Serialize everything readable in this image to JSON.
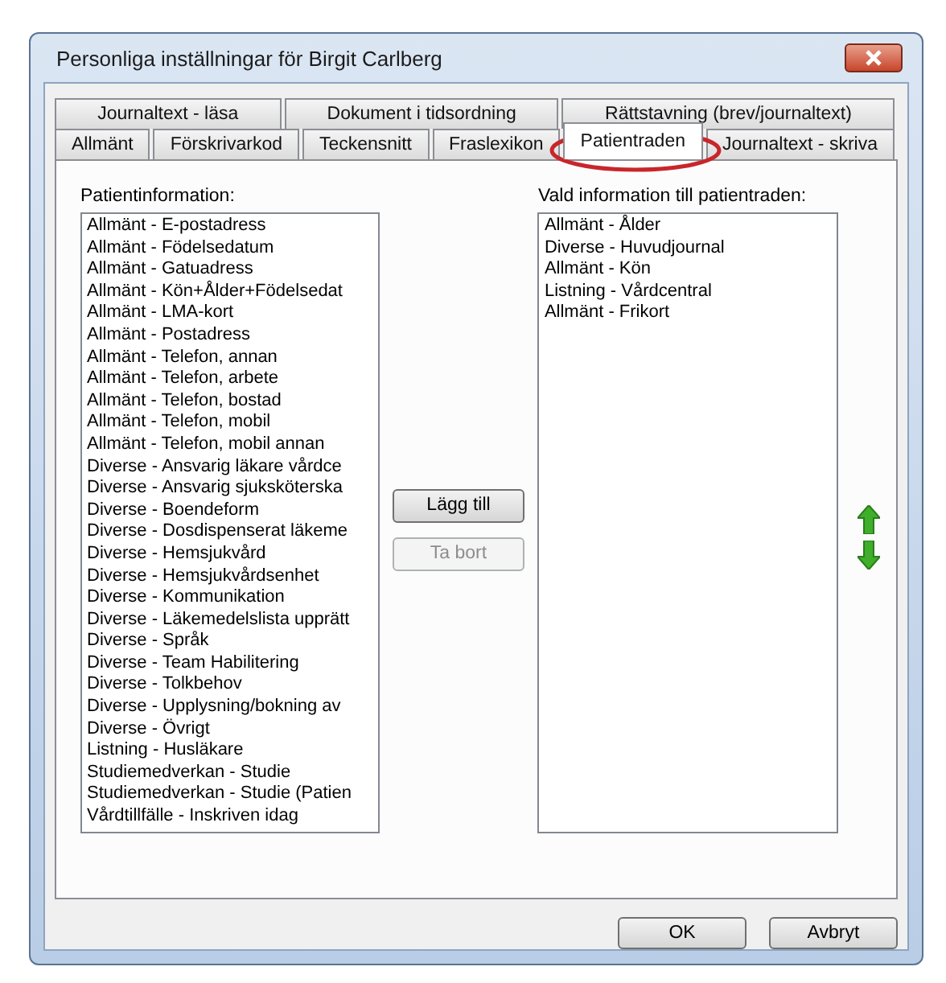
{
  "window": {
    "title": "Personliga inställningar för Birgit Carlberg"
  },
  "tab_rows": [
    [
      {
        "label": "Journaltext - läsa",
        "selected": false
      },
      {
        "label": "Dokument i tidsordning",
        "selected": false
      },
      {
        "label": "Rättstavning (brev/journaltext)",
        "selected": false
      }
    ],
    [
      {
        "label": "Allmänt",
        "selected": false
      },
      {
        "label": "Förskrivarkod",
        "selected": false
      },
      {
        "label": "Teckensnitt",
        "selected": false
      },
      {
        "label": "Fraslexikon",
        "selected": false
      },
      {
        "label": "Patientraden",
        "selected": true
      },
      {
        "label": "Journaltext - skriva",
        "selected": false
      }
    ]
  ],
  "available": {
    "label": "Patientinformation:",
    "items": [
      "Allmänt - E-postadress",
      "Allmänt - Födelsedatum",
      "Allmänt - Gatuadress",
      "Allmänt - Kön+Ålder+Födelsedat",
      "Allmänt - LMA-kort",
      "Allmänt - Postadress",
      "Allmänt - Telefon, annan",
      "Allmänt - Telefon, arbete",
      "Allmänt - Telefon, bostad",
      "Allmänt - Telefon, mobil",
      "Allmänt - Telefon, mobil annan",
      "Diverse - Ansvarig läkare vårdce",
      "Diverse - Ansvarig sjuksköterska",
      "Diverse - Boendeform",
      "Diverse - Dosdispenserat läkeme",
      "Diverse - Hemsjukvård",
      "Diverse - Hemsjukvårdsenhet",
      "Diverse - Kommunikation",
      "Diverse - Läkemedelslista upprätt",
      "Diverse - Språk",
      "Diverse - Team Habilitering",
      "Diverse - Tolkbehov",
      "Diverse - Upplysning/bokning av",
      "Diverse - Övrigt",
      "Listning - Husläkare",
      "Studiemedverkan - Studie",
      "Studiemedverkan - Studie (Patien",
      "Vårdtillfälle - Inskriven idag"
    ]
  },
  "actions": [
    {
      "label": "Lägg till",
      "disabled": false
    },
    {
      "label": "Ta bort",
      "disabled": true
    }
  ],
  "selected_list": {
    "label": "Vald information till patientraden:",
    "items": [
      "Allmänt - Ålder",
      "Diverse - Huvudjournal",
      "Allmänt - Kön",
      "Listning - Vårdcentral",
      "Allmänt - Frikort"
    ]
  },
  "buttons": [
    "OK",
    "Avbryt"
  ]
}
